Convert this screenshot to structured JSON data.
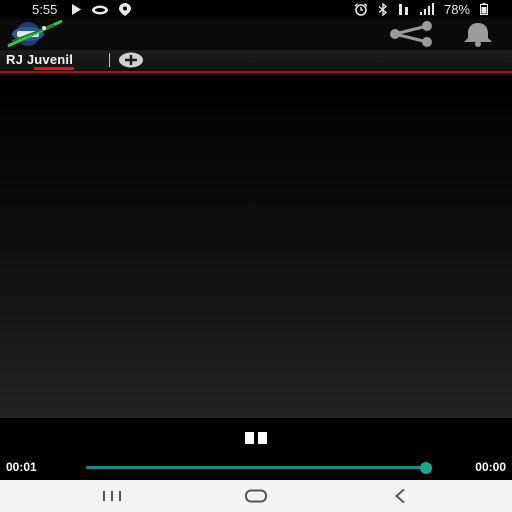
{
  "status_bar": {
    "time": "5:55",
    "battery_text": "78%",
    "left_icons": [
      "play-store-icon",
      "cloud-icon",
      "location-icon"
    ],
    "right_icons": [
      "alarm-icon",
      "bluetooth-icon",
      "data-icon",
      "signal-icon",
      "battery-icon"
    ]
  },
  "app_bar": {
    "logo_icon": "station-logo-icon",
    "actions": [
      "share-icon",
      "bell-icon"
    ]
  },
  "tabs": [
    {
      "label": "RJ Juvenil",
      "selected": true
    }
  ],
  "add_tab_icon": "plus-circle-icon",
  "player": {
    "state_icon": "pause-icon",
    "current_time": "00:01",
    "total_time": "00:00",
    "progress_fraction": 1.0
  },
  "nav_bar": {
    "buttons": [
      "recent-apps-icon",
      "home-icon",
      "back-icon"
    ]
  },
  "colors": {
    "accent_red": "#e01818",
    "seek_teal": "#1a8f82"
  }
}
